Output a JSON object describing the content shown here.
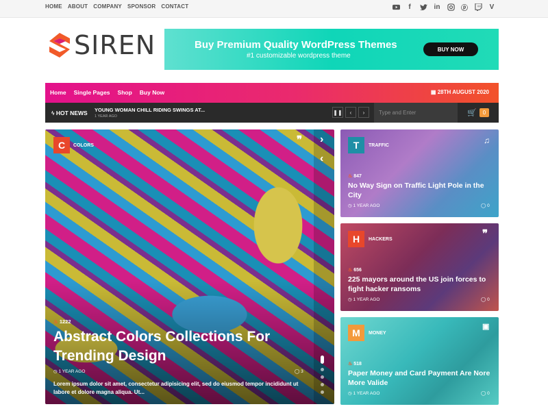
{
  "topbar": {
    "nav": [
      "HOME",
      "ABOUT",
      "COMPANY",
      "SPONSOR",
      "CONTACT"
    ],
    "social_icons": [
      "youtube-icon",
      "facebook-icon",
      "twitter-icon",
      "linkedin-icon",
      "instagram-icon",
      "pinterest-icon",
      "twitch-icon",
      "vimeo-icon"
    ]
  },
  "logo": {
    "text": "SIREN",
    "accent": "#f15a29"
  },
  "banner": {
    "headline": "Buy Premium Quality WordPress Themes",
    "subline": "#1 customizable wordpress theme",
    "button": "BUY NOW",
    "color": "#19d9b8"
  },
  "menu": {
    "items": [
      "Home",
      "Single Pages",
      "Shop",
      "Buy Now"
    ],
    "date": "28TH AUGUST 2020"
  },
  "ticker": {
    "label": "HOT NEWS",
    "headline": "YOUNG WOMAN CHILL RIDING SWINGS AT...",
    "time": "1 YEAR AGO",
    "search_placeholder": "Type and Enter",
    "cart_count": "0"
  },
  "hero": {
    "badge": "C",
    "badge_color": "#e8472b",
    "category": "COLORS",
    "views": "1222",
    "title": "Abstract Colors Collections For Trending Design",
    "time": "1 YEAR AGO",
    "comments": "3",
    "excerpt": "Lorem ipsum dolor sit amet, consectetur adipisicing elit, sed do eiusmod tempor incididunt ut labore et dolore magna aliqua. Ut..."
  },
  "cards": [
    {
      "badge": "T",
      "badge_color": "#1e8fa6",
      "category": "TRAFFIC",
      "views": "847",
      "title": "No Way Sign on Traffic Light Pole in the City",
      "time": "1 YEAR AGO",
      "comments": "0",
      "icon": "music-icon"
    },
    {
      "badge": "H",
      "badge_color": "#e8472b",
      "category": "HACKERS",
      "views": "656",
      "title": "225 mayors around the US join forces to fight hacker ransoms",
      "time": "1 YEAR AGO",
      "comments": "0",
      "icon": "quote-icon"
    },
    {
      "badge": "M",
      "badge_color": "#f39a3c",
      "category": "MONEY",
      "views": "518",
      "title": "Paper Money and Card Payment Are Nore More Valide",
      "time": "1 YEAR AGO",
      "comments": "0",
      "icon": "gallery-icon"
    }
  ]
}
